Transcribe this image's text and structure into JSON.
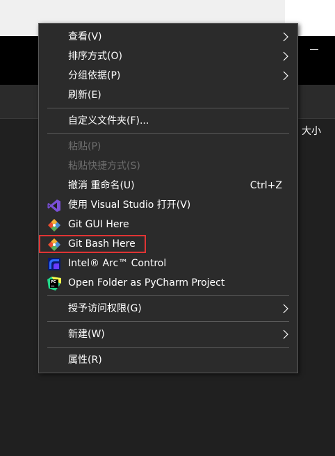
{
  "background": {
    "column_header_size": "大小"
  },
  "menu": {
    "items": [
      {
        "label": "查看(V)",
        "submenu": true
      },
      {
        "label": "排序方式(O)",
        "submenu": true
      },
      {
        "label": "分组依据(P)",
        "submenu": true
      },
      {
        "label": "刷新(E)"
      },
      {
        "label": "自定义文件夹(F)..."
      },
      {
        "label": "粘贴(P)",
        "disabled": true
      },
      {
        "label": "粘贴快捷方式(S)",
        "disabled": true
      },
      {
        "label": "撤消 重命名(U)",
        "shortcut": "Ctrl+Z"
      },
      {
        "label": "使用 Visual Studio 打开(V)",
        "icon": "visual-studio-icon"
      },
      {
        "label": "Git GUI Here",
        "icon": "git-icon"
      },
      {
        "label": "Git Bash Here",
        "icon": "git-icon",
        "highlighted": true
      },
      {
        "label": "Intel® Arc™ Control",
        "icon": "intel-arc-icon"
      },
      {
        "label": "Open Folder as PyCharm Project",
        "icon": "pycharm-icon"
      },
      {
        "label": "授予访问权限(G)",
        "submenu": true
      },
      {
        "label": "新建(W)",
        "submenu": true
      },
      {
        "label": "属性(R)"
      }
    ]
  },
  "colors": {
    "menu_background": "#2b2b2b",
    "highlight_border": "#e03434",
    "disabled_text": "#6d6d6d"
  }
}
